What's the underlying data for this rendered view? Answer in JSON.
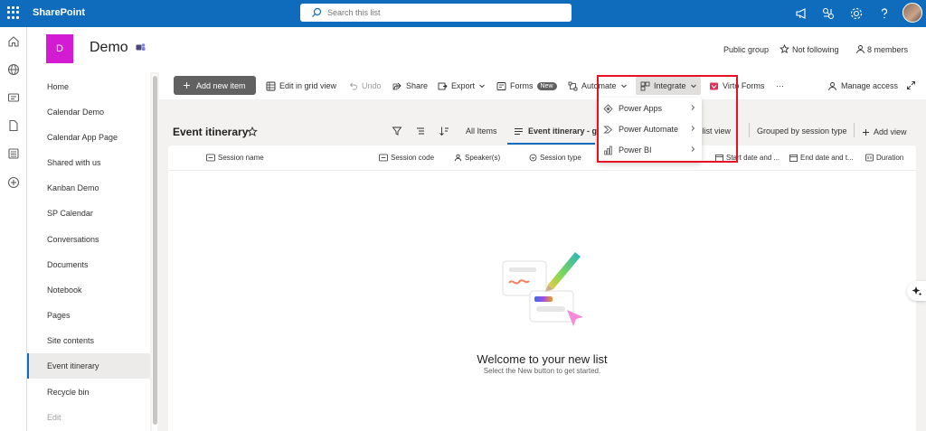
{
  "suitebar": {
    "app_name": "SharePoint",
    "search_placeholder": "Search this list"
  },
  "site": {
    "logo_letter": "D",
    "title": "Demo",
    "visibility": "Public group",
    "follow_label": "Not following",
    "members_label": "8 members"
  },
  "nav": {
    "items": [
      {
        "label": "Home"
      },
      {
        "label": "Calendar Demo"
      },
      {
        "label": "Calendar App Page"
      },
      {
        "label": "Shared with us"
      },
      {
        "label": "Kanban Demo"
      },
      {
        "label": "SP Calendar"
      },
      {
        "label": "Conversations"
      },
      {
        "label": "Documents"
      },
      {
        "label": "Notebook"
      },
      {
        "label": "Pages"
      },
      {
        "label": "Site contents"
      },
      {
        "label": "Event itinerary"
      },
      {
        "label": "Recycle bin"
      },
      {
        "label": "Edit"
      }
    ],
    "selected": "Event itinerary"
  },
  "commands": {
    "add_new": "Add new item",
    "edit_grid": "Edit in grid view",
    "undo": "Undo",
    "share": "Share",
    "export": "Export",
    "forms": "Forms",
    "forms_badge": "New",
    "automate": "Automate",
    "integrate": "Integrate",
    "virto_forms": "Virto Forms",
    "more": "···",
    "manage_access": "Manage access"
  },
  "integrate_menu": {
    "items": [
      {
        "label": "Power Apps"
      },
      {
        "label": "Power Automate"
      },
      {
        "label": "Power BI"
      }
    ]
  },
  "list": {
    "title": "Event itinerary",
    "views": {
      "all_items": "All Items",
      "active": "Event itinerary - gr",
      "list_view_fragment": "y - list view",
      "grouped": "Grouped by session type",
      "add_view": "Add view"
    },
    "columns": [
      "Session name",
      "Session code",
      "Speaker(s)",
      "Session type",
      "Start date and ...",
      "End date and t...",
      "Duration"
    ],
    "empty_title": "Welcome to your new list",
    "empty_subtitle": "Select the New button to get started."
  },
  "colors": {
    "suitebar": "#0f6cbd",
    "site_logo": "#d41bd4",
    "highlight": "#e81123"
  }
}
